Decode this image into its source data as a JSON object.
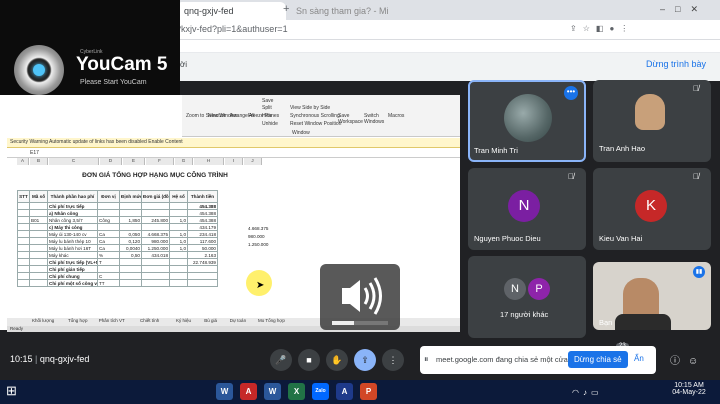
{
  "browser": {
    "tabs": [
      {
        "label": "qnq-gxjv-fed"
      },
      {
        "label": "Sn sàng tham gia? - Microsoft Edge"
      }
    ],
    "url": "?kxjv-fed?pli=1&authuser=1",
    "new_tab": "+",
    "back": "←",
    "forward": "→",
    "reload": "↻"
  },
  "banner": {
    "text": "ời",
    "present_button": "Dừng trình bày"
  },
  "youcam": {
    "brand": "CyberLink",
    "title": "YouCam 5",
    "subtitle": "Please Start YouCam"
  },
  "excel": {
    "security_warning": "Security Warning   Automatic update of links has been disabled   Enable Content",
    "cell_ref": "E17",
    "sheet_title": "ĐƠN GIÁ TỔNG HỢP HẠNG MỤC CÔNG TRÌNH",
    "columns": [
      "A",
      "B",
      "C",
      "D",
      "E",
      "F",
      "G",
      "H",
      "I",
      "J"
    ],
    "ribbon_labels": [
      "Save",
      "View Side by Side",
      "Synchronous Scrolling",
      "Reset Window Position",
      "Switch Windows",
      "Macros",
      "Freeze Panes",
      "New Window",
      "Arrange All",
      "Hide",
      "Unhide",
      "Split",
      "Window",
      "Zoom to Selection",
      "Save Workspace"
    ],
    "headers": [
      "STT",
      "Mã số",
      "Thành phần hao phí",
      "Đơn vị",
      "Định mức",
      "Đơn giá (đồng)",
      "Hệ số",
      "Thành tiền"
    ],
    "rows": [
      [
        "",
        "",
        "Chi phí trực tiếp",
        "",
        "",
        "",
        "",
        "454.388"
      ],
      [
        "",
        "",
        "a) Nhân công",
        "",
        "",
        "",
        "",
        "454.388"
      ],
      [
        "",
        "B01",
        "Nhân công 3,5/7",
        "Công",
        "1,850",
        "245.800",
        "1,0",
        "454.388"
      ],
      [
        "",
        "",
        "c) Máy thi công",
        "",
        "",
        "",
        "",
        "434.179"
      ],
      [
        "",
        "",
        "Máy ủi 130-140 cv",
        "Ca",
        "0,050",
        "4.668.375",
        "1,0",
        "234.418"
      ],
      [
        "",
        "",
        "Máy lu bánh thép 10",
        "Ca",
        "0,120",
        "980.000",
        "1,0",
        "117.600"
      ],
      [
        "",
        "",
        "Máy lu bánh hơi 16T",
        "Ca",
        "0,0040",
        "1.250.000",
        "1,0",
        "50.000"
      ],
      [
        "",
        "",
        "Máy khác",
        "%",
        "0,50",
        "434.018",
        "",
        "2.163"
      ],
      [
        "",
        "",
        "Chi phí trực tiếp (VL+NC+MTC)",
        "T",
        "",
        "",
        "",
        "22.748.939"
      ],
      [
        "",
        "",
        "Chi phí gián tiếp",
        "",
        "",
        "",
        "",
        ""
      ],
      [
        "",
        "",
        "Chi phí chung",
        "C",
        "",
        "",
        "",
        ""
      ],
      [
        "",
        "",
        "Chi phí một số công việc không xác định được khối lượng từ thiết kế",
        "TT",
        "",
        "",
        "",
        ""
      ]
    ],
    "extra_col": [
      "4.668.375",
      "980.000",
      "1.250.000"
    ],
    "sheet_tabs": [
      "Khối lượng",
      "Tổng hợp",
      "Phân tích VT",
      "Chiết tính",
      "Ký hiệu",
      "Bù giá",
      "Dự toán",
      "Mo Tổng hợp"
    ],
    "status": "Ready"
  },
  "participants": [
    {
      "name": "Tran Minh Tri",
      "muted": false
    },
    {
      "name": "Tran Anh Hao",
      "muted": true
    },
    {
      "name": "Nguyen Phuoc Dieu",
      "initial": "N",
      "color": "#7b1fa2",
      "muted": true
    },
    {
      "name": "Kieu Van Hai",
      "initial": "K",
      "color": "#c62828",
      "muted": true
    },
    {
      "name": "17 người khác",
      "initials": [
        "N",
        "P"
      ],
      "colors": [
        "#5f6368",
        "#8e24aa"
      ]
    },
    {
      "name": "Bạn"
    }
  ],
  "meeting": {
    "time": "10:15",
    "code": "qnq-gxjv-fed",
    "share_text": "meet.google.com đang chia sẻ một cửa sổ.",
    "stop_share": "Dừng chia sẻ",
    "hide": "Ẩn",
    "badge": "23"
  },
  "taskbar": {
    "time": "10:15 AM",
    "date": "04-May-22",
    "apps": [
      "W",
      "A",
      "W",
      "X",
      "Zalo",
      "A",
      "P"
    ],
    "app_colors": [
      "#2b579a",
      "#c62828",
      "#2b579a",
      "#217346",
      "#0068ff",
      "#1e3a8a",
      "#d24726"
    ]
  },
  "colors": {
    "meet_bg": "#202124",
    "tile": "#3c4043",
    "accent": "#1a73e8"
  }
}
